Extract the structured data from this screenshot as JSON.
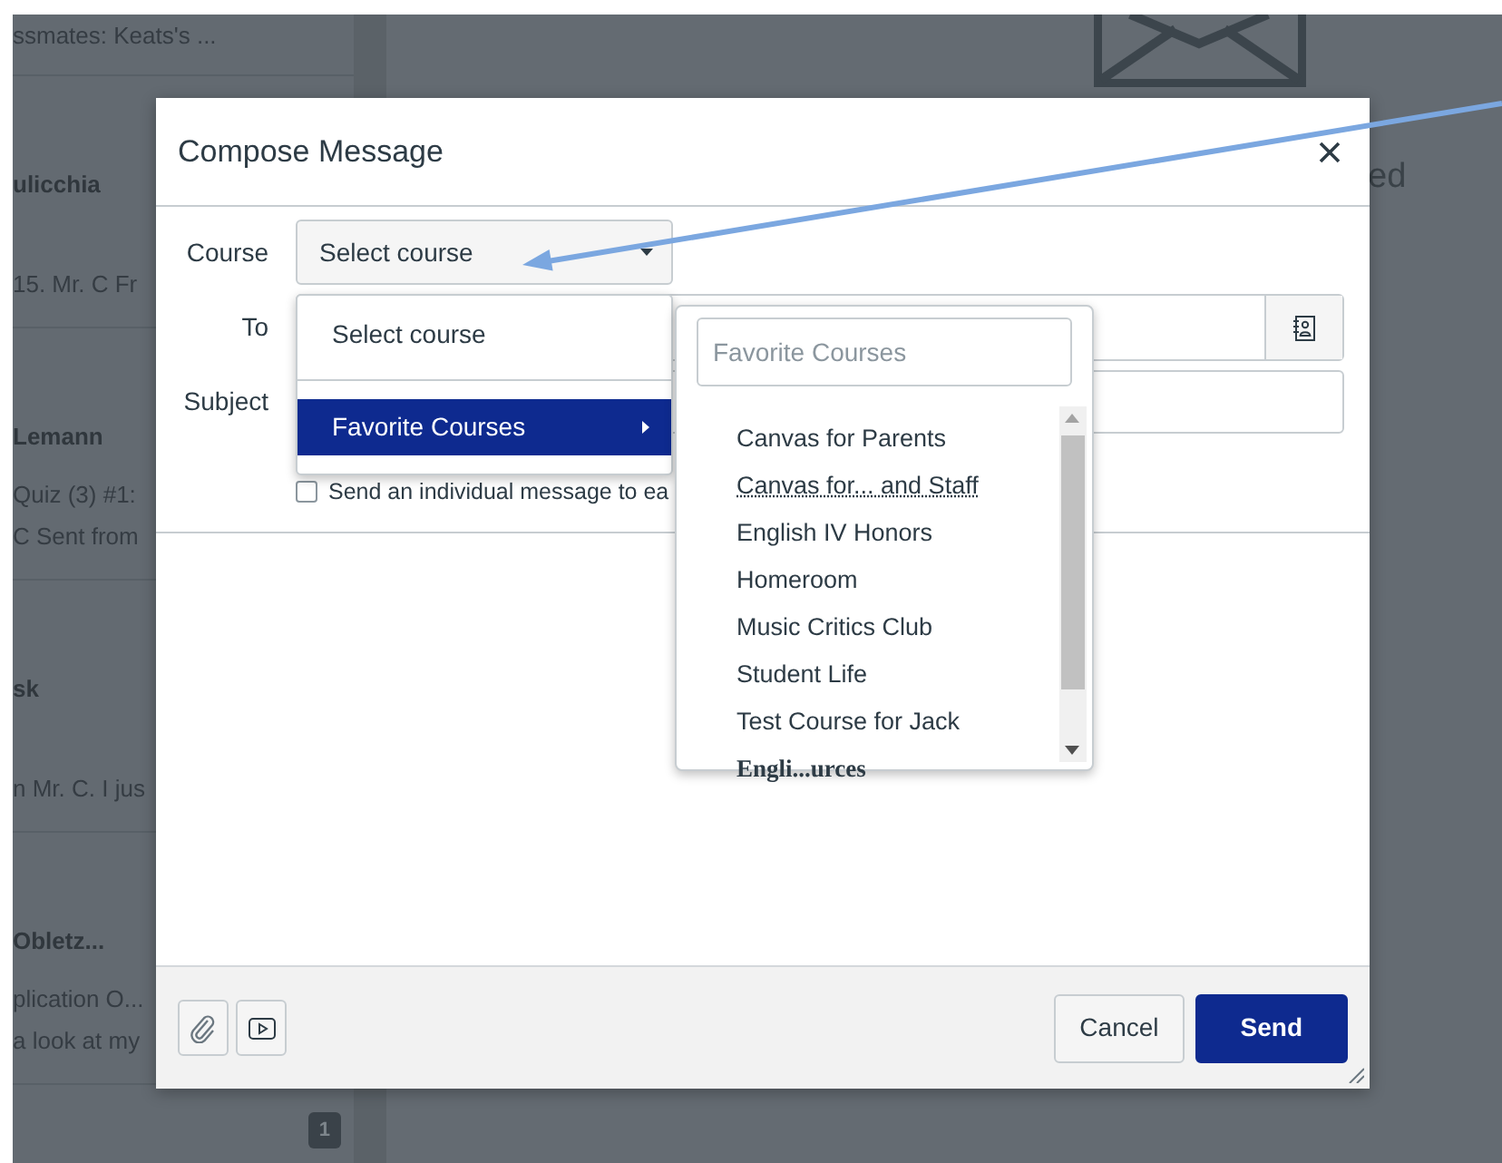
{
  "background": {
    "messages": [
      {
        "lines": [
          "ssmates: Keats's ..."
        ]
      },
      {
        "name": "ulicchia",
        "lines": [
          "15. Mr. C Fr"
        ]
      },
      {
        "name": "Lemann",
        "lines": [
          "Quiz (3) #1:",
          "C Sent from"
        ]
      },
      {
        "name": "sk",
        "lines": [
          "n Mr. C. I jus"
        ]
      },
      {
        "name": "Obletz...",
        "lines": [
          "plication O...",
          "a look at my"
        ]
      }
    ],
    "badge": "1",
    "right_text": "ed"
  },
  "dialog": {
    "title": "Compose Message",
    "fields": [
      {
        "label": "Course",
        "kind": "select",
        "value": "Select course"
      },
      {
        "label": "To",
        "kind": "recipients"
      },
      {
        "label": "Subject",
        "kind": "text"
      }
    ],
    "individual_message": {
      "label": "Send an individual message to ea",
      "checked": false
    },
    "course_menu": [
      {
        "label": "Select course",
        "selected": false,
        "submenu": false
      },
      {
        "label": "Favorite Courses",
        "selected": true,
        "submenu": true
      }
    ],
    "submenu": {
      "placeholder": "Favorite Courses",
      "items": [
        {
          "label": "Canvas for Parents",
          "kind": "course"
        },
        {
          "label": "Canvas for... and Staff",
          "kind": "abbr"
        },
        {
          "label": "English IV Honors",
          "kind": "course"
        },
        {
          "label": "Homeroom",
          "kind": "course"
        },
        {
          "label": "Music Critics Club",
          "kind": "course"
        },
        {
          "label": "Student Life",
          "kind": "course"
        },
        {
          "label": "Test Course for Jack",
          "kind": "course"
        },
        {
          "label": "Engli...urces",
          "kind": "group"
        }
      ]
    },
    "buttons": [
      {
        "label": "Cancel",
        "kind": "secondary"
      },
      {
        "label": "Send",
        "kind": "primary"
      }
    ]
  }
}
